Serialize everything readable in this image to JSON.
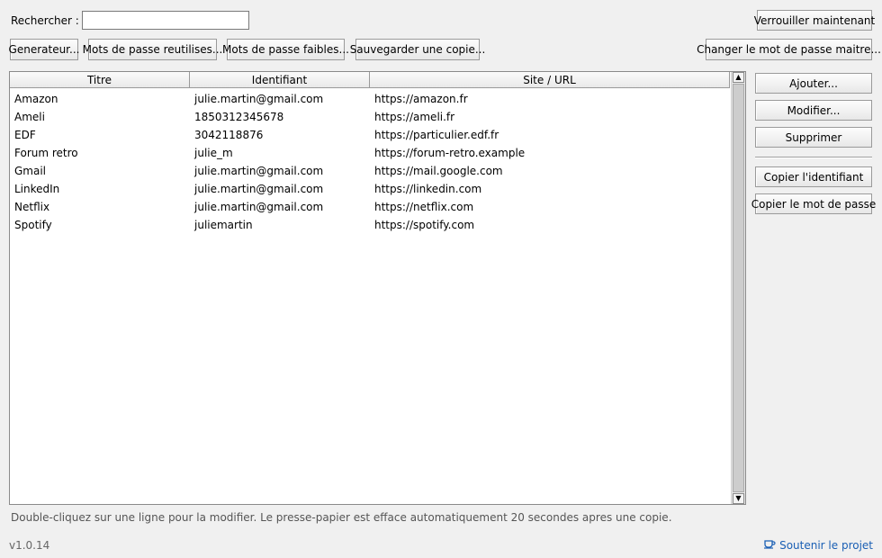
{
  "search": {
    "label": "Rechercher :",
    "value": ""
  },
  "toolbar": {
    "generator": "Generateur...",
    "reused": "Mots de passe reutilises...",
    "weak": "Mots de passe faibles...",
    "backup": "Sauvegarder une copie...",
    "lock": "Verrouiller maintenant",
    "change_master": "Changer le mot de passe maitre..."
  },
  "table": {
    "columns": [
      "Titre",
      "Identifiant",
      "Site / URL"
    ],
    "rows": [
      [
        "Amazon",
        "julie.martin@gmail.com",
        "https://amazon.fr"
      ],
      [
        "Ameli",
        "1850312345678",
        "https://ameli.fr"
      ],
      [
        "EDF",
        "3042118876",
        "https://particulier.edf.fr"
      ],
      [
        "Forum retro",
        "julie_m",
        "https://forum-retro.example"
      ],
      [
        "Gmail",
        "julie.martin@gmail.com",
        "https://mail.google.com"
      ],
      [
        "LinkedIn",
        "julie.martin@gmail.com",
        "https://linkedin.com"
      ],
      [
        "Netflix",
        "julie.martin@gmail.com",
        "https://netflix.com"
      ],
      [
        "Spotify",
        "juliemartin",
        "https://spotify.com"
      ]
    ]
  },
  "side": {
    "add": "Ajouter...",
    "edit": "Modifier...",
    "delete": "Supprimer",
    "copy_id": "Copier l'identifiant",
    "copy_pw": "Copier le mot de passe"
  },
  "footer": {
    "hint": "Double-cliquez sur une ligne pour la modifier. Le presse-papier est efface automatiquement 20 secondes apres une copie.",
    "version": "v1.0.14",
    "support": "Soutenir le projet"
  },
  "icons": {
    "support": "coffee-cup-icon",
    "scroll_up": "up-arrow-icon",
    "scroll_down": "down-arrow-icon"
  },
  "colors": {
    "link": "#1a5fb4",
    "window_bg": "#f0f0f0"
  }
}
